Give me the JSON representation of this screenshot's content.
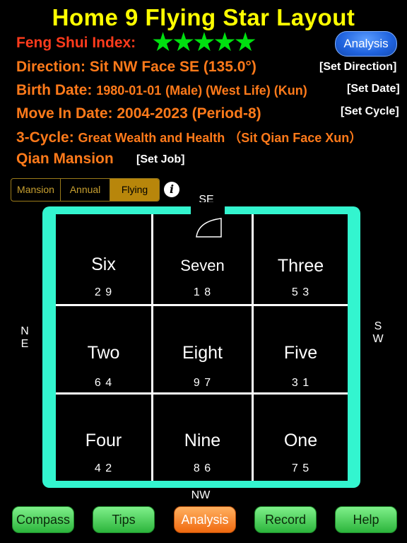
{
  "title": "Home 9 Flying Star Layout",
  "feng_shui": {
    "label": "Feng Shui Index:",
    "stars": "★★★★★"
  },
  "analysis_button": "Analysis",
  "direction": {
    "text": "Direction:  Sit NW Face SE   (135.0°)",
    "link": "[Set Direction]"
  },
  "birth": {
    "label": "Birth Date:",
    "value": "1980-01-01",
    "extra": "(Male) (West Life) (Kun)",
    "link": "[Set Date]"
  },
  "move": {
    "text": "Move In Date:  2004-2023 (Period-8)",
    "link": "[Set Cycle]"
  },
  "cycle": {
    "label": "3-Cycle:",
    "value": "Great Wealth and Health  （Sit Qian Face Xun）"
  },
  "mansion": {
    "text": "Qian Mansion",
    "link": "[Set Job]"
  },
  "segments": [
    "Mansion",
    "Annual",
    "Flying"
  ],
  "active_segment": "Flying",
  "info_icon": "i",
  "directions": {
    "top": "SE",
    "left_1": "N",
    "left_2": "E",
    "right_1": "S",
    "right_2": "W",
    "bottom": "NW"
  },
  "cells": [
    {
      "name": "Six",
      "nums": "2 9"
    },
    {
      "name": "Seven",
      "nums": "1 8"
    },
    {
      "name": "Three",
      "nums": "5 3"
    },
    {
      "name": "Two",
      "nums": "6 4"
    },
    {
      "name": "Eight",
      "nums": "9 7"
    },
    {
      "name": "Five",
      "nums": "3 1"
    },
    {
      "name": "Four",
      "nums": "4 2"
    },
    {
      "name": "Nine",
      "nums": "8 6"
    },
    {
      "name": "One",
      "nums": "7 5"
    }
  ],
  "buttons": [
    "Compass",
    "Tips",
    "Analysis",
    "Record",
    "Help"
  ],
  "colors": {
    "title": "#ffff00",
    "info": "#ff7a1a",
    "index_label": "#ff3b1c",
    "stars": "#00e010",
    "frame": "#33f5cf",
    "button_green": "#2cb53c",
    "button_orange": "#f06a10"
  }
}
